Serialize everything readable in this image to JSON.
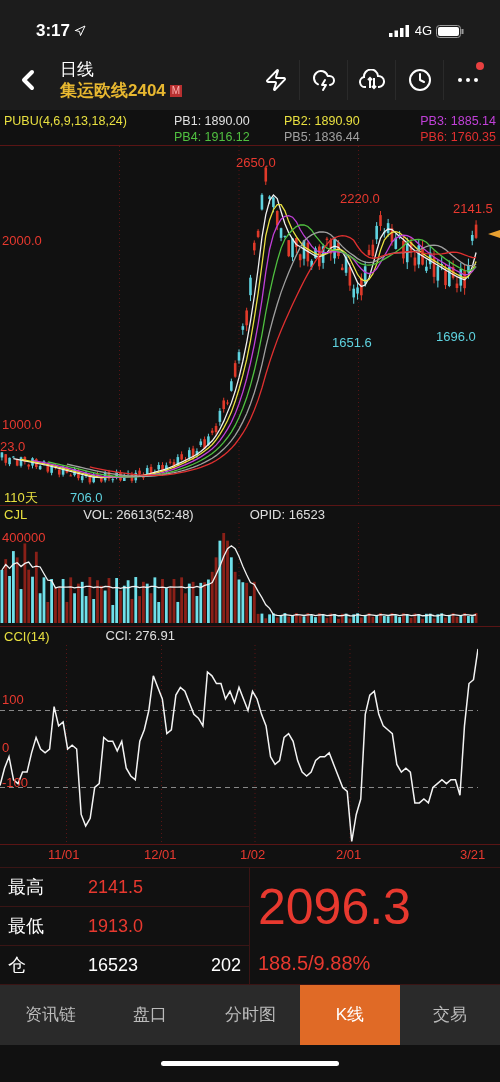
{
  "status_bar": {
    "time": "3:17",
    "network": "4G"
  },
  "header": {
    "title": "日线",
    "subtitle": "集运欧线2404",
    "badge": "M",
    "menu_alert": true
  },
  "indicator": {
    "name": "PUBU(4,6,9,13,18,24)",
    "values": [
      {
        "text": "PB1: 1890.00",
        "color": "#e0e0e0"
      },
      {
        "text": "PB2: 1890.90",
        "color": "#e8e040"
      },
      {
        "text": "PB3: 1885.14",
        "color": "#c040d8"
      },
      {
        "text": "PB4: 1916.12",
        "color": "#50c040"
      },
      {
        "text": "PB5: 1836.44",
        "color": "#a0a0a0"
      },
      {
        "text": "PB6: 1760.35",
        "color": "#e03030"
      }
    ]
  },
  "price_chart": {
    "labels": [
      {
        "text": "2650.0",
        "kind": "high"
      },
      {
        "text": "2220.0",
        "kind": "high"
      },
      {
        "text": "2141.5",
        "kind": "high"
      },
      {
        "text": "2000.0",
        "kind": "axis"
      },
      {
        "text": "1651.6",
        "kind": "low"
      },
      {
        "text": "1696.0",
        "kind": "low"
      },
      {
        "text": "1000.0",
        "kind": "axis"
      },
      {
        "text": "23.0",
        "kind": "axis"
      },
      {
        "text": "110天",
        "kind": "period"
      },
      {
        "text": "706.0",
        "kind": "low"
      }
    ]
  },
  "volume": {
    "name": "CJL",
    "vol": "VOL: 26613(52:48)",
    "opid": "OPID: 16523",
    "axis": "400000"
  },
  "cci": {
    "name": "CCI(14)",
    "value": "CCI: 276.91",
    "axis": [
      "100",
      "0",
      "-100"
    ]
  },
  "dates": [
    "11/01",
    "12/01",
    "1/02",
    "2/01",
    "3/21"
  ],
  "quote": {
    "rows": [
      {
        "label": "最高",
        "value": "2141.5",
        "kind": "price"
      },
      {
        "label": "最低",
        "value": "1913.0",
        "kind": "price"
      },
      {
        "label": "仓",
        "value": "16523",
        "extra": "202",
        "kind": "count"
      }
    ],
    "price": "2096.3",
    "change": "188.5/9.88%"
  },
  "tabs": [
    {
      "label": "资讯链",
      "selected": false
    },
    {
      "label": "盘口",
      "selected": false
    },
    {
      "label": "分时图",
      "selected": false
    },
    {
      "label": "K线",
      "selected": true
    },
    {
      "label": "交易",
      "selected": false
    }
  ]
}
